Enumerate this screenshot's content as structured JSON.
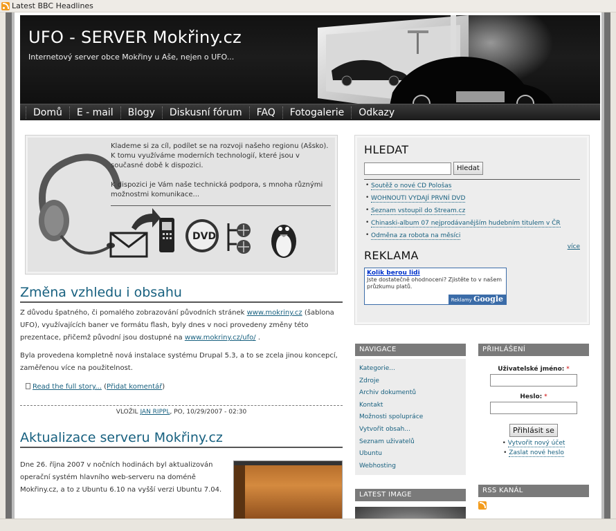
{
  "feed_bar": {
    "label": "Latest BBC Headlines"
  },
  "header": {
    "title": "UFO - SERVER Mokřiny.cz",
    "slogan": "Internetový server obce Mokřiny u Aše, nejen o UFO..."
  },
  "nav": [
    "Domů",
    "E - mail",
    "Blogy",
    "Diskusní fórum",
    "FAQ",
    "Fotogalerie",
    "Odkazy"
  ],
  "promo": {
    "text1": "Klademe si za cíl, podílet se na rozvoji našeho regionu (Ašsko). K tomu využíváme moderních technologií, které jsou v současné době k dispozici.",
    "text2": "K dispozici je Vám naše technická podpora, s mnoha různými možnostmi komunikace..."
  },
  "post1": {
    "title": "Změna vzhledu i obsahu",
    "p1_a": "Z důvodu špatného, či pomalého zobrazování původních stránek ",
    "p1_link1": "www.mokriny.cz",
    "p1_b": " (šablona UFO), využívajících baner ve formátu flash, byly dnes v noci provedeny změny této prezentace, přičemž původní jsou dostupné na ",
    "p1_link2": "www.mokriny.cz/ufo/",
    "p1_c": " .",
    "p2": "Byla provedena kompletně nová instalace systému Drupal 5.3, a to se zcela jinou koncepcí, zaměřenou více na použitelnost.",
    "read_more": "Read the full story...",
    "add_comment": "Přidat komentář",
    "meta_prefix": "VLOŽIL ",
    "meta_author": "JAN RIPPL",
    "meta_date": ", PO, 10/29/2007 - 02:30"
  },
  "post2": {
    "title": "Aktualizace serveru Mokřiny.cz",
    "p1": "Dne 26. října 2007 v nočních hodinách byl aktualizován operační systém hlavního web-serveru na doméně Mokřiny.cz, a to z Ubuntu 6.10 na vyšší verzi Ubuntu 7.04."
  },
  "search": {
    "heading": "HLEDAT",
    "button": "Hledat",
    "news": [
      "Soutěž o nové CD Pološas",
      "WOHNOUTI VYDAJÍ PRVNÍ DVD",
      "Seznam vstoupil do Stream.cz",
      "Chinaski-album 07 nejprodávanějším hudebním titulem v ČR",
      "Odměna za robota na měsíci"
    ],
    "more": "více"
  },
  "ads": {
    "heading": "REKLAMA",
    "title": "Kolik berou lidi",
    "text": "Jste dostatečně ohodnoceni? Zjistěte to v našem průzkumu platů.",
    "footer_prefix": "Reklamy ",
    "footer_brand": "Google"
  },
  "navigace": {
    "heading": "NAVIGACE",
    "items": [
      "Kategorie...",
      "Zdroje",
      "Archiv dokumentů",
      "Kontakt",
      "Možnosti spolupráce",
      "Vytvořit obsah...",
      "Seznam uživatelů",
      "Ubuntu",
      "Webhosting"
    ]
  },
  "latest_image": {
    "heading": "LATEST IMAGE"
  },
  "login": {
    "heading": "PŘIHLÁŠENÍ",
    "username_label": "Uživatelské jméno:",
    "password_label": "Heslo:",
    "required": "*",
    "button": "Přihlásit se",
    "links": [
      "Vytvořit nový účet",
      "Zaslat nové heslo"
    ]
  },
  "rss": {
    "heading": "RSS KANÁL"
  }
}
